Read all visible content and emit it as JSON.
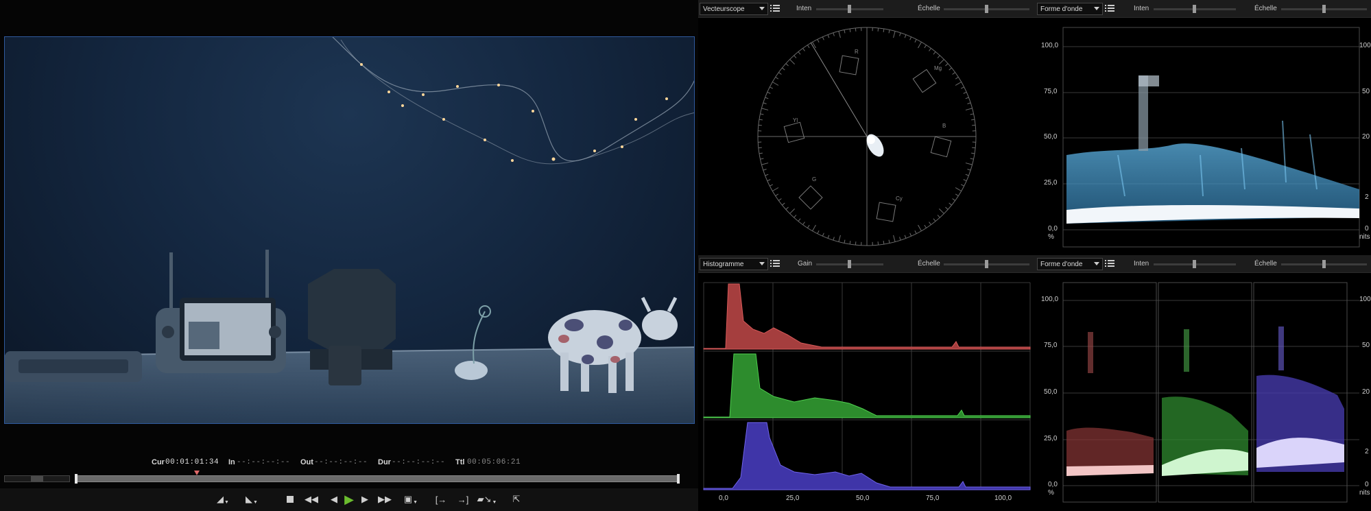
{
  "player": {
    "timecode": {
      "cur_label": "Cur",
      "cur_value": "00:01:01:34",
      "in_label": "In",
      "in_value": "--:--:--:--",
      "out_label": "Out",
      "out_value": "--:--:--:--",
      "dur_label": "Dur",
      "dur_value": "--:--:--:--",
      "ttl_label": "Ttl",
      "ttl_value": "00:05:06:21"
    },
    "controls": [
      "mark-in",
      "mark-out",
      "stop",
      "rewind",
      "step-back",
      "play",
      "step-forward",
      "fast-forward",
      "loop",
      "match-in",
      "match-out",
      "insert",
      "export"
    ],
    "accent": "#6bbd2e",
    "frame_border": "#2f5a9e"
  },
  "scopes": {
    "vectorscope": {
      "select_value": "Vecteurscope",
      "inten_label": "Inten",
      "inten_level": 0.5,
      "scale_label": "Échelle",
      "scale_level": 0.5,
      "targets": [
        "R",
        "Mg",
        "B",
        "Cy",
        "G",
        "Yl"
      ]
    },
    "waveform_top": {
      "select_value": "Forme d'onde",
      "inten_label": "Inten",
      "inten_level": 0.5,
      "scale_label": "Échelle",
      "scale_level": 0.5,
      "left_ticks": [
        "100,0",
        "75,0",
        "50,0",
        "25,0",
        "0,0"
      ],
      "left_unit": "%",
      "right_ticks": [
        "100",
        "50",
        "20",
        "2",
        "0"
      ],
      "right_unit": "nits"
    },
    "histogram": {
      "select_value": "Histogramme",
      "gain_label": "Gain",
      "gain_level": 0.5,
      "scale_label": "Échelle",
      "scale_level": 0.5,
      "x_ticks": [
        "0,0",
        "25,0",
        "50,0",
        "75,0",
        "100,0"
      ],
      "channel_colors": [
        "#c04848",
        "#3fae3f",
        "#5a4fd0"
      ]
    },
    "waveform_rgb": {
      "select_value": "Forme d'onde",
      "inten_label": "Inten",
      "inten_level": 0.5,
      "scale_label": "Échelle",
      "scale_level": 0.5,
      "left_ticks": [
        "100,0",
        "75,0",
        "50,0",
        "25,0",
        "0,0"
      ],
      "left_unit": "%",
      "right_ticks": [
        "100",
        "50",
        "20",
        "2",
        "0"
      ],
      "right_unit": "nits"
    }
  }
}
